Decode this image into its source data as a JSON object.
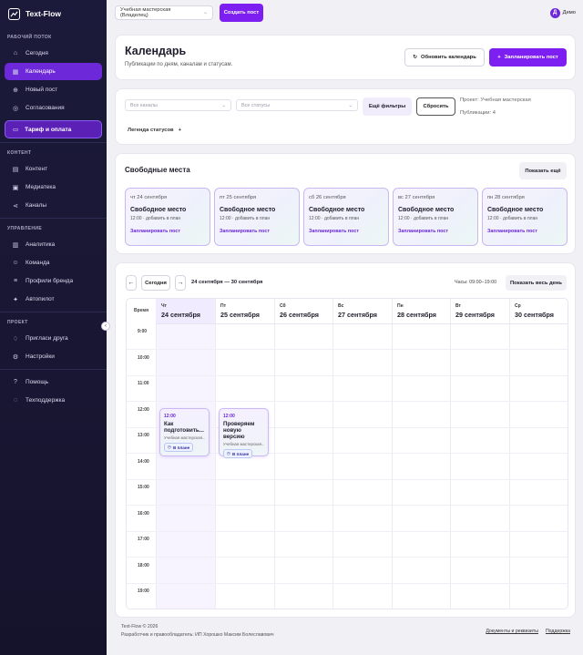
{
  "app": {
    "name": "Text-Flow"
  },
  "sidebar": {
    "sections": {
      "work": "РАБОЧИЙ ПОТОК",
      "content": "КОНТЕНТ",
      "manage": "УПРАВЛЕНИЕ",
      "project": "ПРОЕКТ"
    },
    "work_items": [
      {
        "label": "Сегодня",
        "icon": "home-icon",
        "active": false
      },
      {
        "label": "Календарь",
        "icon": "calendar-icon",
        "active": true
      },
      {
        "label": "Новый пост",
        "icon": "plus-circle-icon",
        "active": false
      },
      {
        "label": "Согласования",
        "icon": "check-circle-icon",
        "active": false
      }
    ],
    "tarif": {
      "label": "Тариф и оплата",
      "icon": "card-icon"
    },
    "content_items": [
      {
        "label": "Контент",
        "icon": "grid-icon"
      },
      {
        "label": "Медиатека",
        "icon": "image-icon"
      },
      {
        "label": "Каналы",
        "icon": "share-icon"
      }
    ],
    "manage_items": [
      {
        "label": "Аналитика",
        "icon": "chart-icon"
      },
      {
        "label": "Команда",
        "icon": "team-icon"
      },
      {
        "label": "Профили бренда",
        "icon": "sliders-icon"
      },
      {
        "label": "Автопилот",
        "icon": "autopilot-icon"
      }
    ],
    "project_items": [
      {
        "label": "Пригласи друга",
        "icon": "gift-icon"
      },
      {
        "label": "Настройки",
        "icon": "gear-icon"
      }
    ],
    "help_items": [
      {
        "label": "Помощь",
        "icon": "help-icon"
      },
      {
        "label": "Техподдержка",
        "icon": "chat-icon"
      }
    ]
  },
  "topbar": {
    "workspace": "Учебная мастерская (Владелец)",
    "create_post": "Создать пост",
    "user_initial": "Д",
    "user_name": "Демо"
  },
  "header": {
    "title": "Календарь",
    "subtitle": "Публикации по дням, каналам и статусам.",
    "refresh": "Обновить календарь",
    "schedule": "Запланировать пост"
  },
  "filters": {
    "channels_placeholder": "Все каналы",
    "statuses_placeholder": "Все статусы",
    "more": "Ещё фильтры",
    "reset": "Сбросить",
    "project": "Проект: Учебная мастерская",
    "publications": "Публикации: 4",
    "legend": "Легенда статусов",
    "legend_toggle": "+"
  },
  "free_slots": {
    "title": "Свободные места",
    "show_more": "Показать ещё",
    "items": [
      {
        "date": "чт 24 сентября",
        "title": "Свободное место",
        "hint": "12:00 · добавить в план",
        "action": "Запланировать пост"
      },
      {
        "date": "пт 25 сентября",
        "title": "Свободное место",
        "hint": "12:00 · добавить в план",
        "action": "Запланировать пост"
      },
      {
        "date": "сб 26 сентября",
        "title": "Свободное место",
        "hint": "12:00 · добавить в план",
        "action": "Запланировать пост"
      },
      {
        "date": "вс 27 сентября",
        "title": "Свободное место",
        "hint": "12:00 · добавить в план",
        "action": "Запланировать пост"
      },
      {
        "date": "пн 28 сентября",
        "title": "Свободное место",
        "hint": "12:00 · добавить в план",
        "action": "Запланировать пост"
      }
    ]
  },
  "calendar": {
    "prev": "←",
    "today": "Сегодня",
    "next": "→",
    "range": "24 сентября — 30 сентября",
    "hours": "Часы: 09:00–19:00",
    "show_day": "Показать весь день",
    "time_header": "Время",
    "days": [
      {
        "weekday": "Чт",
        "date": "24 сентября",
        "today": true
      },
      {
        "weekday": "Пт",
        "date": "25 сентября",
        "today": false
      },
      {
        "weekday": "Сб",
        "date": "26 сентября",
        "today": false
      },
      {
        "weekday": "Вс",
        "date": "27 сентября",
        "today": false
      },
      {
        "weekday": "Пн",
        "date": "28 сентября",
        "today": false
      },
      {
        "weekday": "Вт",
        "date": "29 сентября",
        "today": false
      },
      {
        "weekday": "Ср",
        "date": "30 сентября",
        "today": false
      }
    ],
    "times": [
      "9:00",
      "10:00",
      "11:00",
      "12:00",
      "13:00",
      "14:00",
      "15:00",
      "16:00",
      "17:00",
      "18:00",
      "19:00"
    ],
    "events": [
      {
        "day_index": 0,
        "time": "12:00",
        "title": "Как подготовить...",
        "project": "Учебная мастерская...",
        "status": "В плане"
      },
      {
        "day_index": 1,
        "time": "12:00",
        "title": "Проверяем новую версию",
        "project": "Учебная мастерская...",
        "status": "В плане"
      }
    ]
  },
  "footer": {
    "copyright": "Text-Flow © 2026",
    "developer": "Разработчик и правообладатель: ИП Хорошко Максим Болеславович",
    "docs": "Документы и реквизиты",
    "support": "Поддержка"
  },
  "colors": {
    "accent": "#7c1ff0",
    "sidebar_bg": "#1c1a3a",
    "active_nav": "#6d28d9"
  }
}
